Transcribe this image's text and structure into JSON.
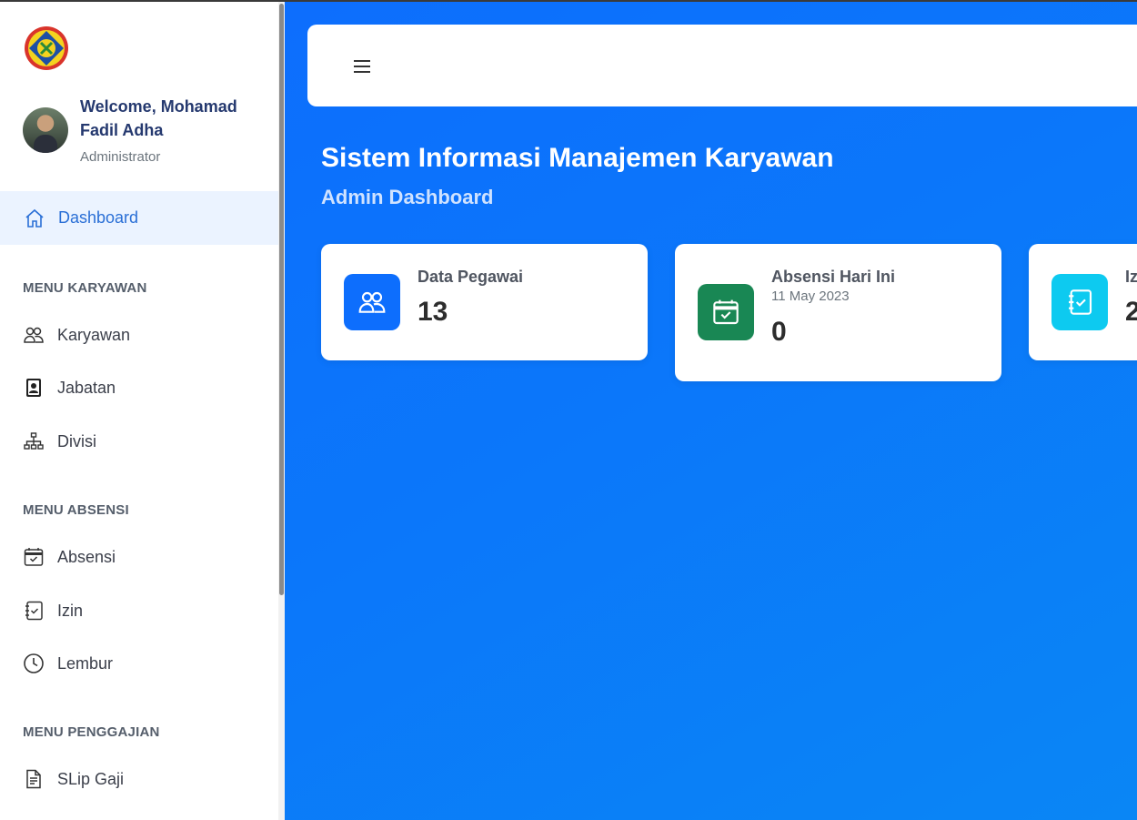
{
  "sidebar": {
    "welcome": "Welcome, Mohamad Fadil Adha",
    "role": "Administrator",
    "dashboard_label": "Dashboard",
    "sections": {
      "karyawan_title": "MENU KARYAWAN",
      "absensi_title": "MENU ABSENSI",
      "penggajian_title": "MENU PENGGAJIAN"
    },
    "items": {
      "karyawan": "Karyawan",
      "jabatan": "Jabatan",
      "divisi": "Divisi",
      "absensi": "Absensi",
      "izin": "Izin",
      "lembur": "Lembur",
      "slip_gaji": "SLip Gaji"
    }
  },
  "header": {
    "title": "Sistem Informasi Manajemen Karyawan",
    "subtitle": "Admin Dashboard"
  },
  "cards": [
    {
      "title": "Data Pegawai",
      "value": "13",
      "color": "#0d6efd",
      "icon": "people-icon"
    },
    {
      "title": "Absensi Hari Ini",
      "date": "11 May 2023",
      "value": "0",
      "color": "#198754",
      "icon": "calendar-check-icon"
    },
    {
      "title": "Iz",
      "value": "2",
      "color": "#0dcaf0",
      "icon": "journal-check-icon"
    }
  ],
  "colors": {
    "primary": "#0d6efd",
    "active_bg": "#ebf3ff",
    "active_text": "#2a6fd6"
  }
}
